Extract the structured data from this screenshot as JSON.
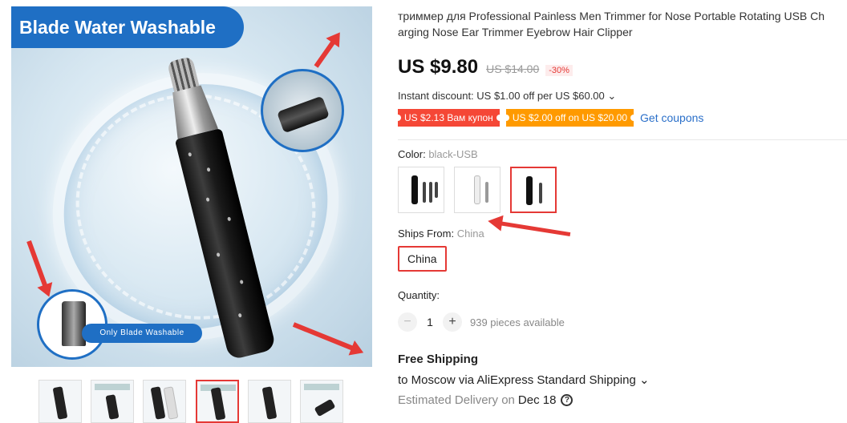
{
  "product": {
    "title": "триммер для Professional Painless Men Trimmer for Nose Portable Rotating USB Ch\narging Nose Ear Trimmer Eyebrow Hair Clipper"
  },
  "gallery": {
    "banner_text": "Blade Water Washable",
    "pill_text": "Only Blade Washable",
    "thumbnails": [
      "thumb-1",
      "thumb-2",
      "thumb-3",
      "thumb-4",
      "thumb-5",
      "thumb-6"
    ],
    "active_thumbnail": 4
  },
  "pricing": {
    "price": "US $9.80",
    "old_price": "US $14.00",
    "discount": "-30%",
    "instant_discount": "Instant discount: US $1.00 off per US $60.00 ⌄",
    "coupons": [
      {
        "text": "US $2.13 Вам купон",
        "color": "#f54736"
      },
      {
        "text": "US $2.00 off on US $20.00",
        "color": "#ff9a00"
      }
    ],
    "get_coupons": "Get coupons"
  },
  "color": {
    "label": "Color:",
    "selected": "black-USB"
  },
  "ships_from": {
    "label": "Ships From:",
    "selected": "China",
    "option": "China"
  },
  "quantity": {
    "label": "Quantity:",
    "minus": "−",
    "value": "1",
    "plus": "+",
    "available": "939 pieces available"
  },
  "shipping": {
    "title": "Free Shipping",
    "destination": "to Moscow via AliExpress Standard Shipping ⌄",
    "estimated_label": "Estimated Delivery on",
    "date": "Dec 18",
    "help": "?"
  },
  "colors": {
    "accent": "#e53935",
    "link": "#2a6fc9",
    "banner": "#1f6fc4"
  }
}
